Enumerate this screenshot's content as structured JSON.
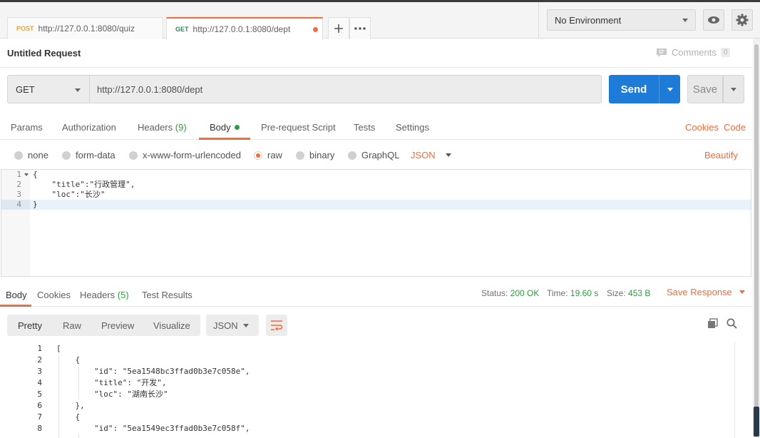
{
  "tabs": [
    {
      "method": "POST",
      "url": "http://127.0.0.1:8080/quiz"
    },
    {
      "method": "GET",
      "url": "http://127.0.0.1:8080/dept"
    }
  ],
  "environment": {
    "selected": "No Environment"
  },
  "request": {
    "title": "Untitled Request",
    "comments_label": "Comments",
    "comments_count": "0",
    "method": "GET",
    "url": "http://127.0.0.1:8080/dept",
    "send_label": "Send",
    "save_label": "Save"
  },
  "request_tabs": {
    "params": "Params",
    "authorization": "Authorization",
    "headers": "Headers",
    "headers_count": "(9)",
    "body": "Body",
    "prerequest": "Pre-request Script",
    "tests": "Tests",
    "settings": "Settings",
    "cookies": "Cookies",
    "code": "Code"
  },
  "body_types": {
    "none": "none",
    "form_data": "form-data",
    "urlencoded": "x-www-form-urlencoded",
    "raw": "raw",
    "binary": "binary",
    "graphql": "GraphQL",
    "format": "JSON",
    "beautify": "Beautify"
  },
  "request_body": [
    {
      "n": "1",
      "code": "{"
    },
    {
      "n": "2",
      "code": "    \"title\":\"行政管理\","
    },
    {
      "n": "3",
      "code": "    \"loc\":\"长沙\""
    },
    {
      "n": "4",
      "code": "}"
    }
  ],
  "response_tabs": {
    "body": "Body",
    "cookies": "Cookies",
    "headers": "Headers",
    "headers_count": "(5)",
    "test_results": "Test Results"
  },
  "response_status": {
    "status_label": "Status:",
    "status_value": "200 OK",
    "time_label": "Time:",
    "time_value": "19.60 s",
    "size_label": "Size:",
    "size_value": "453 B",
    "save_response": "Save Response"
  },
  "response_view": {
    "pretty": "Pretty",
    "raw": "Raw",
    "preview": "Preview",
    "visualize": "Visualize",
    "format": "JSON"
  },
  "response_body": [
    {
      "n": "1",
      "code": "["
    },
    {
      "n": "2",
      "code": "    {"
    },
    {
      "n": "3",
      "code": "        \"id\": \"5ea1548bc3ffad0b3e7c058e\","
    },
    {
      "n": "4",
      "code": "        \"title\": \"开发\","
    },
    {
      "n": "5",
      "code": "        \"loc\": \"湖南长沙\""
    },
    {
      "n": "6",
      "code": "    },"
    },
    {
      "n": "7",
      "code": "    {"
    },
    {
      "n": "8",
      "code": "        \"id\": \"5ea1549ec3ffad0b3e7c058f\","
    }
  ],
  "colors": {
    "accent": "#f26b3a",
    "send": "#1f7bd8",
    "success": "#2c9c3e"
  }
}
